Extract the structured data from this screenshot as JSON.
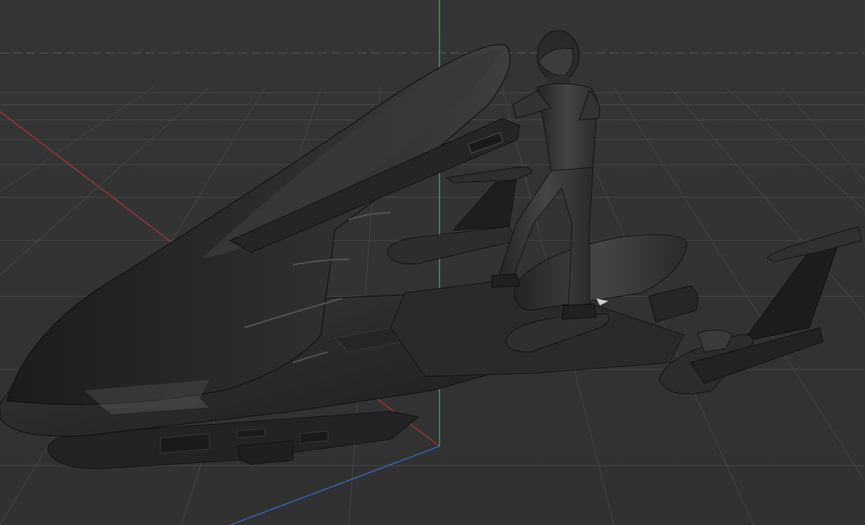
{
  "viewport": {
    "background_color": "#333333",
    "grid_color": "#4a4a4a",
    "axis_x_color": "#b83a3a",
    "axis_y_color": "#3aa866",
    "axis_z_color": "#3f68c8",
    "horizon_dash_color": "#555555",
    "model_base_color": "#2c2c2c",
    "model_highlight_color": "#4a4a4a",
    "model_shadow_color": "#161616"
  },
  "scene": {
    "objects": [
      "surfboard-vehicle",
      "rider-figure",
      "rider-helmet",
      "left-wing-fin",
      "right-tail-fin",
      "rear-engine-pod"
    ]
  }
}
